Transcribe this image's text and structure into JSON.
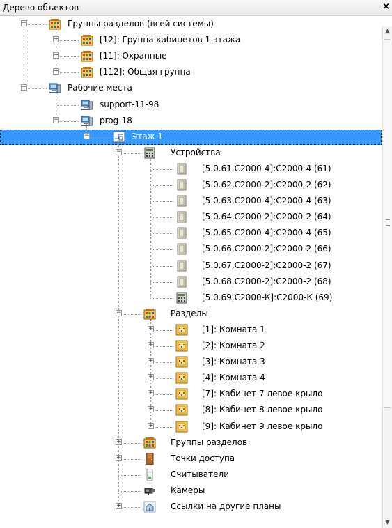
{
  "window": {
    "title": "Дерево объектов",
    "close": "×"
  },
  "tree": {
    "rows": [
      {
        "level": 0,
        "expander": "minus",
        "icon": "group",
        "label": "Группы разделов (всей системы)"
      },
      {
        "level": 1,
        "expander": "plus",
        "icon": "group",
        "label": "[12]: Группа кабинетов 1 этажа"
      },
      {
        "level": 1,
        "expander": "plus",
        "icon": "group",
        "label": "[11]: Охранные"
      },
      {
        "level": 1,
        "expander": "plus",
        "icon": "group",
        "label": "[112]: Общая группа"
      },
      {
        "level": 0,
        "expander": "minus",
        "icon": "workstation",
        "label": "Рабочие места"
      },
      {
        "level": 1,
        "expander": "none",
        "icon": "workstation",
        "label": "support-11-98"
      },
      {
        "level": 1,
        "expander": "minus",
        "icon": "workstation",
        "label": "prog-18"
      },
      {
        "level": 2,
        "expander": "minus",
        "icon": "floor",
        "label": "Этаж 1",
        "selected": true
      },
      {
        "level": 3,
        "expander": "minus",
        "icon": "devices",
        "label": "Устройства"
      },
      {
        "level": 4,
        "expander": "none",
        "icon": "device",
        "label": "[5.0.61,C2000-4]:C2000-4 (61)"
      },
      {
        "level": 4,
        "expander": "none",
        "icon": "device",
        "label": "[5.0.62,C2000-2]:C2000-2 (62)"
      },
      {
        "level": 4,
        "expander": "none",
        "icon": "device",
        "label": "[5.0.63,C2000-4]:C2000-4 (63)"
      },
      {
        "level": 4,
        "expander": "none",
        "icon": "device",
        "label": "[5.0.64,C2000-2]:C2000-2 (64)"
      },
      {
        "level": 4,
        "expander": "none",
        "icon": "device",
        "label": "[5.0.65,C2000-4]:C2000-4 (65)"
      },
      {
        "level": 4,
        "expander": "none",
        "icon": "device",
        "label": "[5.0.66,C2000-2]:C2000-2 (66)"
      },
      {
        "level": 4,
        "expander": "none",
        "icon": "device",
        "label": "[5.0.67,C2000-2]:C2000-2 (67)"
      },
      {
        "level": 4,
        "expander": "none",
        "icon": "device",
        "label": "[5.0.68,C2000-2]:C2000-2 (68)"
      },
      {
        "level": 4,
        "expander": "none",
        "icon": "keypad",
        "label": "[5.0.69,C2000-К]:C2000-К (69)"
      },
      {
        "level": 3,
        "expander": "minus",
        "icon": "group",
        "label": "Разделы"
      },
      {
        "level": 4,
        "expander": "plus",
        "icon": "zone",
        "label": "[1]: Комната 1"
      },
      {
        "level": 4,
        "expander": "plus",
        "icon": "zone",
        "label": "[2]: Комната 2"
      },
      {
        "level": 4,
        "expander": "plus",
        "icon": "zone",
        "label": "[3]: Комната 3"
      },
      {
        "level": 4,
        "expander": "plus",
        "icon": "zone",
        "label": "[4]: Комната 4"
      },
      {
        "level": 4,
        "expander": "plus",
        "icon": "zone",
        "label": "[7]: Кабинет 7 левое крыло"
      },
      {
        "level": 4,
        "expander": "plus",
        "icon": "zone",
        "label": "[8]: Кабинет 8 левое крыло"
      },
      {
        "level": 4,
        "expander": "plus",
        "icon": "zone",
        "label": "[9]: Кабинет 9 левое крыло"
      },
      {
        "level": 3,
        "expander": "plus",
        "icon": "group",
        "label": "Группы разделов"
      },
      {
        "level": 3,
        "expander": "plus",
        "icon": "door",
        "label": "Точки доступа"
      },
      {
        "level": 3,
        "expander": "none",
        "icon": "reader",
        "label": "Считыватели"
      },
      {
        "level": 3,
        "expander": "none",
        "icon": "camera",
        "label": "Камеры"
      },
      {
        "level": 3,
        "expander": "plus",
        "icon": "plan-link",
        "label": "Ссылки на другие планы"
      }
    ]
  },
  "scrollbar": {
    "up": "▲",
    "down": "▼"
  }
}
